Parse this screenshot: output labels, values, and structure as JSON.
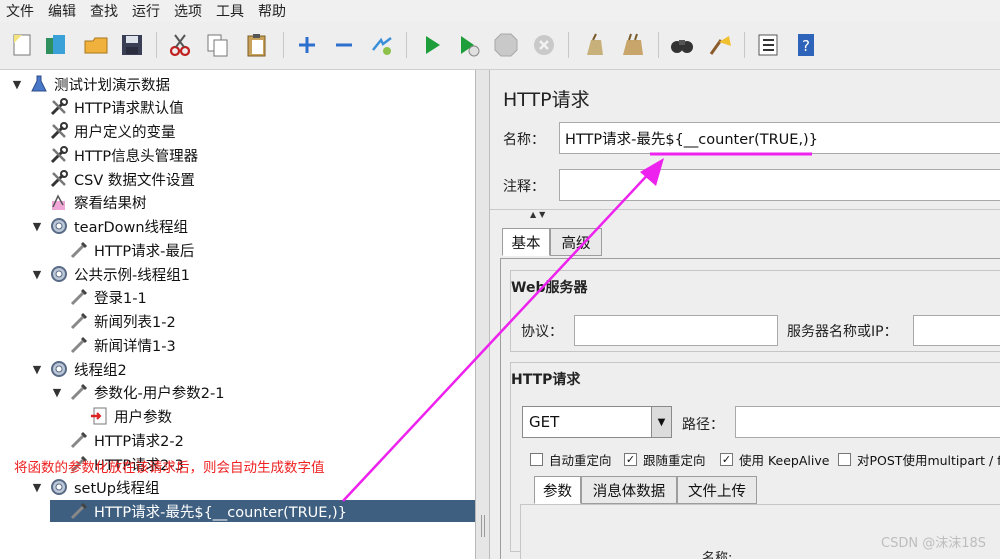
{
  "menu": [
    "文件",
    "编辑",
    "查找",
    "运行",
    "选项",
    "工具",
    "帮助"
  ],
  "toolbar": {
    "icons": [
      "new-icon",
      "templates-icon",
      "open-icon",
      "save-icon",
      "cut-icon",
      "copy-icon",
      "paste-icon",
      "expand-icon",
      "collapse-icon",
      "toggle-icon",
      "start-icon",
      "start-no-pause-icon",
      "stop-icon",
      "shutdown-icon",
      "clear-icon",
      "clear-all-icon",
      "search-icon",
      "reset-search-icon",
      "function-helper-icon",
      "help-icon"
    ]
  },
  "tree": {
    "nodes": [
      {
        "label": "测试计划演示数据",
        "depth": 0,
        "toggle": "▼",
        "icon": "test-plan-icon"
      },
      {
        "label": "HTTP请求默认值",
        "depth": 1,
        "toggle": "",
        "icon": "config-wrench-icon"
      },
      {
        "label": "用户定义的变量",
        "depth": 1,
        "toggle": "",
        "icon": "config-wrench-icon"
      },
      {
        "label": "HTTP信息头管理器",
        "depth": 1,
        "toggle": "",
        "icon": "config-wrench-icon"
      },
      {
        "label": "CSV 数据文件设置",
        "depth": 1,
        "toggle": "",
        "icon": "config-wrench-icon"
      },
      {
        "label": "察看结果树",
        "depth": 1,
        "toggle": "",
        "icon": "listener-icon"
      },
      {
        "label": "tearDown线程组",
        "depth": 1,
        "toggle": "▼",
        "icon": "thread-group-icon"
      },
      {
        "label": "HTTP请求-最后",
        "depth": 2,
        "toggle": "",
        "icon": "sampler-pipette-icon"
      },
      {
        "label": "公共示例-线程组1",
        "depth": 1,
        "toggle": "▼",
        "icon": "thread-group-icon"
      },
      {
        "label": "登录1-1",
        "depth": 2,
        "toggle": "",
        "icon": "sampler-pipette-icon"
      },
      {
        "label": "新闻列表1-2",
        "depth": 2,
        "toggle": "",
        "icon": "sampler-pipette-icon"
      },
      {
        "label": "新闻详情1-3",
        "depth": 2,
        "toggle": "",
        "icon": "sampler-pipette-icon"
      },
      {
        "label": "线程组2",
        "depth": 1,
        "toggle": "▼",
        "icon": "thread-group-icon"
      },
      {
        "label": "参数化-用户参数2-1",
        "depth": 2,
        "toggle": "▼",
        "icon": "sampler-pipette-icon"
      },
      {
        "label": "用户参数",
        "depth": 3,
        "toggle": "",
        "icon": "preprocessor-icon"
      },
      {
        "label": "HTTP请求2-2",
        "depth": 2,
        "toggle": "",
        "icon": "sampler-pipette-icon"
      },
      {
        "label": "HTTP请求2-3",
        "depth": 2,
        "toggle": "",
        "icon": "sampler-pipette-icon"
      },
      {
        "label": "setUp线程组",
        "depth": 1,
        "toggle": "▼",
        "icon": "thread-group-icon"
      },
      {
        "label": "HTTP请求-最先${__counter(TRUE,)}",
        "depth": 2,
        "toggle": "",
        "icon": "sampler-pipette-icon",
        "selected": true
      }
    ]
  },
  "annotation": "将函数的参数化放在该请求后，则会自动生成数字值",
  "panel": {
    "title": "HTTP请求",
    "name_label": "名称：",
    "name_value": "HTTP请求-最先${__counter(TRUE,)}",
    "comment_label": "注释：",
    "comment_value": "",
    "tabs": [
      "基本",
      "高级"
    ],
    "web_server": {
      "section_label": "Web服务器",
      "protocol_label": "协议：",
      "protocol_value": "",
      "server_label": "服务器名称或IP：",
      "server_value": ""
    },
    "http_request": {
      "section_label": "HTTP请求",
      "method": "GET",
      "path_label": "路径：",
      "path_value": "",
      "options": [
        {
          "label": "自动重定向",
          "checked": false
        },
        {
          "label": "跟随重定向",
          "checked": true
        },
        {
          "label": "使用 KeepAlive",
          "checked": true
        },
        {
          "label": "对POST使用multipart / fo",
          "checked": false
        }
      ],
      "subtabs": [
        "参数",
        "消息体数据",
        "文件上传"
      ],
      "table_header_name": "名称:"
    }
  },
  "watermark": "CSDN @沫沫18S",
  "colors": {
    "selection": "#3e5f80",
    "annotation": "#ee2222",
    "highlight": "#ee22ee"
  }
}
